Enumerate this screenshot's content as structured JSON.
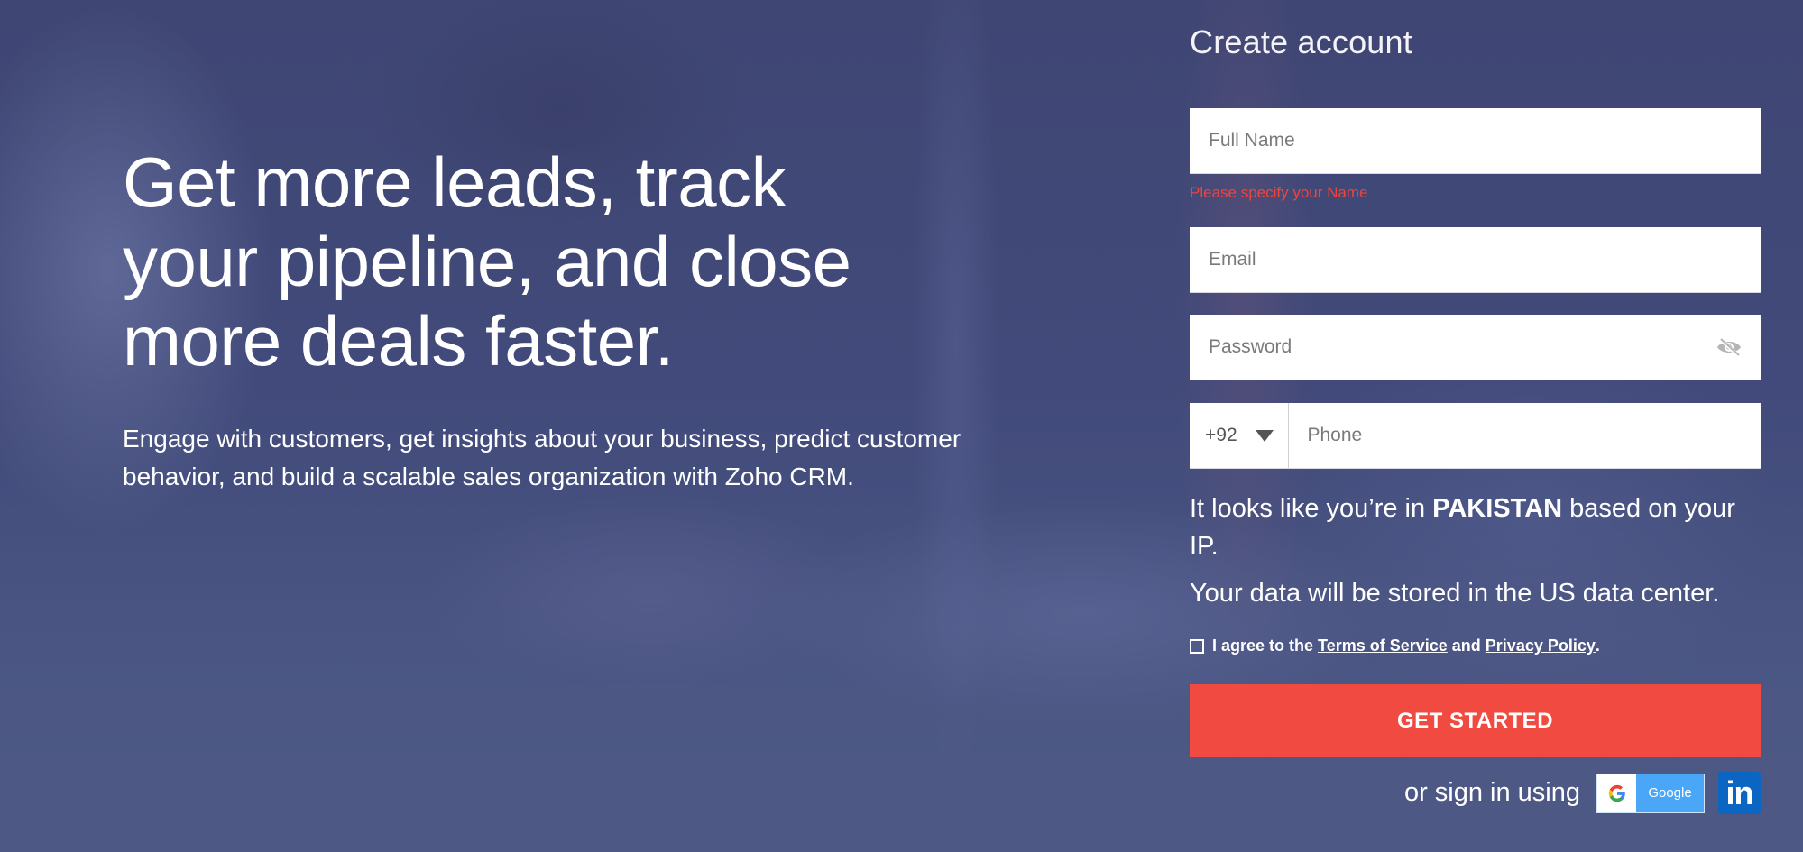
{
  "hero": {
    "headline": "Get more leads, track your pipeline, and close more deals faster.",
    "description": "Engage with customers, get insights about your business, predict customer behavior, and build a scalable sales organization with Zoho CRM."
  },
  "form": {
    "title": "Create account",
    "full_name": {
      "placeholder": "Full Name",
      "value": ""
    },
    "full_name_error": "Please specify your Name",
    "email": {
      "placeholder": "Email",
      "value": ""
    },
    "password": {
      "placeholder": "Password",
      "value": "",
      "toggle_icon": "eye-slash-icon"
    },
    "phone": {
      "country_code": "+92",
      "placeholder": "Phone",
      "value": ""
    },
    "ip_note": {
      "prefix": "It looks like you’re in ",
      "country": "PAKISTAN",
      "suffix": " based on your IP."
    },
    "data_center_note": "Your data will be stored in the US data center.",
    "agree": {
      "checked": false,
      "prefix": "I agree to the",
      "terms_link": "Terms of Service",
      "and": "and",
      "privacy_link": "Privacy Policy",
      "end": "."
    },
    "submit_label": "GET STARTED",
    "social": {
      "label": "or sign in using",
      "google_label": "Google",
      "linkedin_label": "in"
    }
  },
  "colors": {
    "accent": "#f14a40",
    "error": "#f0443c",
    "google": "#4aa7f8",
    "linkedin": "#0a66c2",
    "background_overlay": "#434c7c"
  }
}
